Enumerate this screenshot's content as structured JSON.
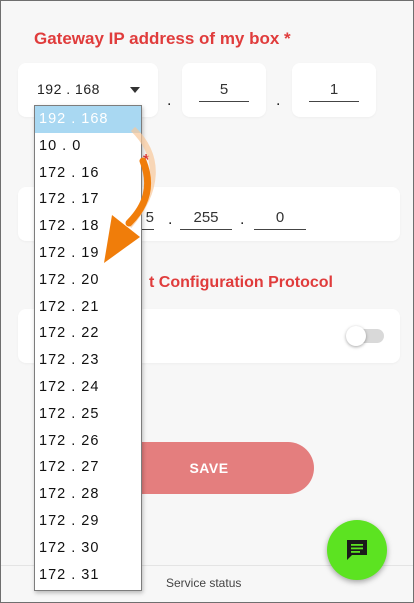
{
  "gateway": {
    "title": "Gateway IP address of my box *",
    "selected_prefix": "192 . 168",
    "octet3": "5",
    "octet4": "1"
  },
  "subnet": {
    "title_partial": "*",
    "octet3": "255",
    "octet4": "0",
    "octet2_partial": "5"
  },
  "dhcp": {
    "title_partial": "t Configuration Protocol",
    "enabled": false
  },
  "save_label": "SAVE",
  "footer": {
    "label": "Service status"
  },
  "dropdown": {
    "options": [
      "192 . 168",
      "10 . 0",
      "172 . 16",
      "172 . 17",
      "172 . 18",
      "172 . 19",
      "172 . 20",
      "172 . 21",
      "172 . 22",
      "172 . 23",
      "172 . 24",
      "172 . 25",
      "172 . 26",
      "172 . 27",
      "172 . 28",
      "172 . 29",
      "172 . 30",
      "172 . 31"
    ],
    "selected_index": 0
  },
  "colors": {
    "accent_red": "#e03c3c",
    "save_button": "#e47e7e",
    "chat_button": "#5ce321",
    "highlight": "#a9d8f2",
    "arrow": "#f07d0a"
  },
  "icons": {
    "chat": "chat-bubble-icon",
    "caret": "caret-down-icon",
    "arrow": "orange-curved-arrow-annotation"
  }
}
